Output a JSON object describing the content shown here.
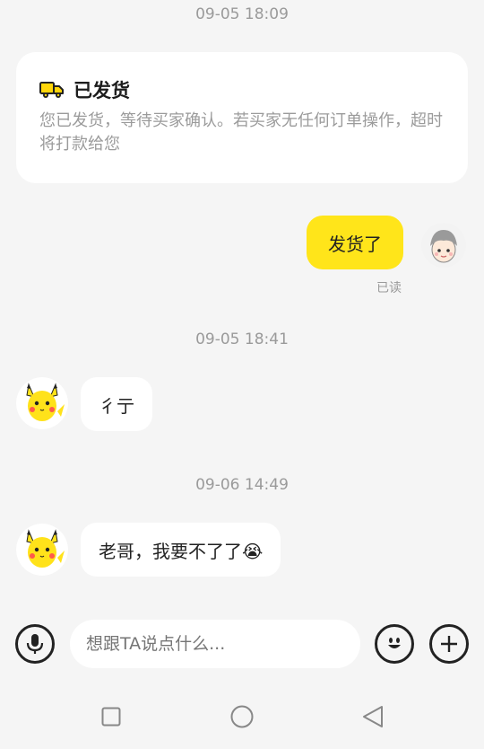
{
  "messages": {
    "time1": "09-05 18:09",
    "card": {
      "title": "已发货",
      "body": "您已发货，等待买家确认。若买家无任何订单操作，超时将打款给您",
      "icon": "truck-icon"
    },
    "sent_text": "发货了",
    "read_status": "已读",
    "time2": "09-05 18:41",
    "reply1": "彳亍",
    "time3": "09-06 14:49",
    "reply2": "老哥，我要不了了😭"
  },
  "input_bar": {
    "placeholder": "想跟TA说点什么...",
    "voice_icon": "microphone-icon",
    "emoji_icon": "emoji-icon",
    "plus_icon": "plus-icon"
  },
  "nav": {
    "recent": "square-icon",
    "home": "circle-icon",
    "back": "triangle-back-icon"
  },
  "colors": {
    "accent": "#ffe51a",
    "background": "#f5f5f5",
    "muted_text": "#9a9a9a"
  }
}
